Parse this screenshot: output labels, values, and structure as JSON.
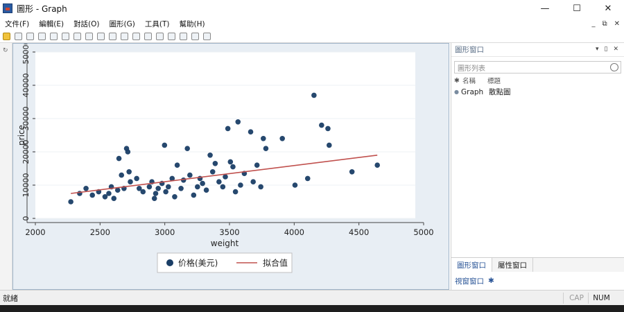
{
  "window": {
    "title": "圖形 - Graph",
    "minimize": "—",
    "maximize": "☐",
    "close": "✕"
  },
  "menu": {
    "items": [
      "文件(F)",
      "編輯(E)",
      "對話(O)",
      "圖形(G)",
      "工具(T)",
      "幫助(H)"
    ],
    "mdi_controls": [
      "_",
      "⧉",
      "✕"
    ]
  },
  "toolbar": {
    "icon_count": 18
  },
  "right_pane": {
    "title": "圖形窗口",
    "header_controls": [
      "▾",
      "▯",
      "✕"
    ],
    "search_placeholder": "圖形列表",
    "columns": [
      "名稱",
      "標題"
    ],
    "rows": [
      {
        "name": "Graph",
        "title": "散點圖"
      }
    ],
    "tabs": [
      "圖形窗口",
      "屬性窗口"
    ],
    "bottom_label": "視窗窗口",
    "bottom_extra": "✱"
  },
  "status": {
    "text": "就緒",
    "caps": "CAP",
    "num": "NUM"
  },
  "colors": {
    "marker": "#1a3e66",
    "fit_line": "#c0504d",
    "plot_bg": "#ffffff",
    "graph_bg": "#e8eef4"
  },
  "chart_data": {
    "type": "scatter",
    "xlabel": "weight",
    "ylabel": "price",
    "xlim": [
      2000,
      5000
    ],
    "ylim": [
      0,
      50000
    ],
    "x_ticks": [
      2000,
      2500,
      3000,
      3500,
      4000,
      4500,
      5000
    ],
    "y_ticks": [
      0,
      10000,
      20000,
      30000,
      40000,
      50000
    ],
    "y_tick_labels": [
      "0",
      "10000",
      "20000",
      "30000",
      "40000",
      "50000"
    ],
    "legend": [
      "价格(美元)",
      "拟合值"
    ],
    "fit_line": [
      [
        2280,
        7500
      ],
      [
        4700,
        19000
      ]
    ],
    "points": [
      [
        2280,
        5000
      ],
      [
        2350,
        7500
      ],
      [
        2400,
        9000
      ],
      [
        2450,
        7000
      ],
      [
        2500,
        8000
      ],
      [
        2550,
        6500
      ],
      [
        2580,
        7500
      ],
      [
        2600,
        9500
      ],
      [
        2620,
        6000
      ],
      [
        2650,
        8500
      ],
      [
        2660,
        18000
      ],
      [
        2680,
        13000
      ],
      [
        2700,
        9000
      ],
      [
        2720,
        21000
      ],
      [
        2730,
        20000
      ],
      [
        2740,
        14000
      ],
      [
        2750,
        11000
      ],
      [
        2800,
        12000
      ],
      [
        2820,
        9000
      ],
      [
        2850,
        8000
      ],
      [
        2900,
        9500
      ],
      [
        2920,
        11000
      ],
      [
        2940,
        6000
      ],
      [
        2950,
        7500
      ],
      [
        2970,
        9000
      ],
      [
        3000,
        10500
      ],
      [
        3020,
        22000
      ],
      [
        3030,
        8000
      ],
      [
        3050,
        9500
      ],
      [
        3080,
        12000
      ],
      [
        3100,
        6500
      ],
      [
        3120,
        16000
      ],
      [
        3150,
        9000
      ],
      [
        3170,
        11500
      ],
      [
        3200,
        21000
      ],
      [
        3220,
        13000
      ],
      [
        3250,
        7000
      ],
      [
        3280,
        9500
      ],
      [
        3300,
        12000
      ],
      [
        3320,
        10500
      ],
      [
        3350,
        8500
      ],
      [
        3380,
        19000
      ],
      [
        3400,
        14000
      ],
      [
        3420,
        16500
      ],
      [
        3450,
        11000
      ],
      [
        3480,
        9500
      ],
      [
        3500,
        12500
      ],
      [
        3520,
        27000
      ],
      [
        3540,
        17000
      ],
      [
        3560,
        15500
      ],
      [
        3580,
        8000
      ],
      [
        3600,
        29000
      ],
      [
        3620,
        10000
      ],
      [
        3650,
        13500
      ],
      [
        3700,
        26000
      ],
      [
        3720,
        11000
      ],
      [
        3750,
        16000
      ],
      [
        3780,
        9500
      ],
      [
        3800,
        24000
      ],
      [
        3820,
        21000
      ],
      [
        3950,
        24000
      ],
      [
        4050,
        10000
      ],
      [
        4150,
        12000
      ],
      [
        4200,
        37000
      ],
      [
        4260,
        28000
      ],
      [
        4310,
        27000
      ],
      [
        4320,
        22000
      ],
      [
        4500,
        14000
      ],
      [
        4700,
        16000
      ]
    ]
  }
}
